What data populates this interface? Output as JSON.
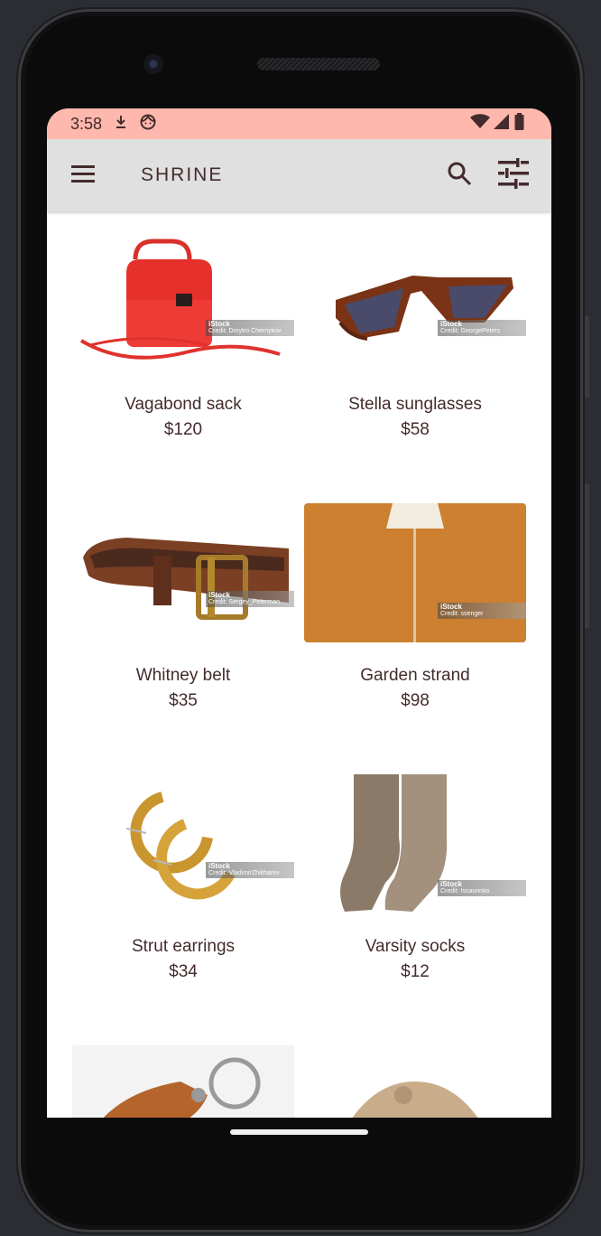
{
  "status_bar": {
    "time": "3:58",
    "bg_color": "#feb8ad",
    "icons_left": [
      "download-notification-icon",
      "face-notification-icon"
    ],
    "icons_right": [
      "wifi-icon",
      "cellular-signal-icon",
      "battery-icon"
    ]
  },
  "app_bar": {
    "title": "SHRINE",
    "bg_color": "#e0e0e0",
    "text_color": "#442b2d",
    "nav_icon": "menu-icon",
    "actions": [
      "search-icon",
      "tune-icon"
    ]
  },
  "products": [
    {
      "name": "Vagabond sack",
      "price": "$120",
      "credit_brand": "iStock",
      "credit": "Credit: Dmytro Chernykov"
    },
    {
      "name": "Stella sunglasses",
      "price": "$58",
      "credit_brand": "iStock",
      "credit": "Credit: GeorgePeters"
    },
    {
      "name": "Whitney belt",
      "price": "$35",
      "credit_brand": "iStock",
      "credit": "Credit: Sergey_Peterman"
    },
    {
      "name": "Garden strand",
      "price": "$98",
      "credit_brand": "iStock",
      "credit": "Credit: ssenger"
    },
    {
      "name": "Strut earrings",
      "price": "$34",
      "credit_brand": "iStock",
      "credit": "Credit: VladimirZhikharev"
    },
    {
      "name": "Varsity socks",
      "price": "$12",
      "credit_brand": "iStock",
      "credit": "Credit: Issaurinko"
    },
    {
      "name": "",
      "price": ""
    },
    {
      "name": "",
      "price": ""
    }
  ]
}
